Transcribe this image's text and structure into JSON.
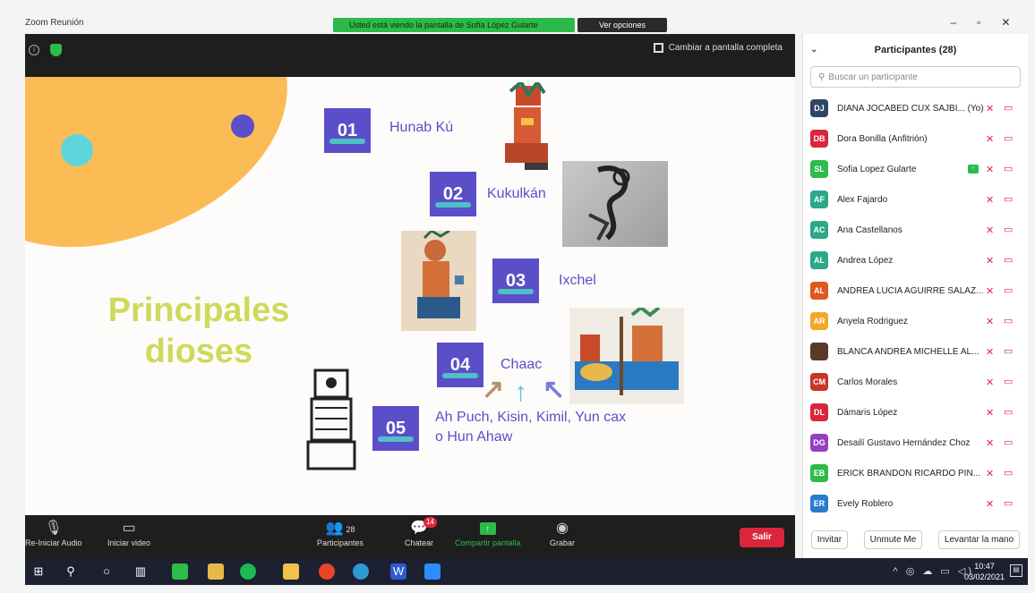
{
  "window": {
    "title": "Zoom Reunión",
    "share_banner": "Usted está viendo la pantalla de Sofía López Gularte",
    "view_options": "Ver opciones"
  },
  "top_bar": {
    "fullscreen_label": "Cambiar a pantalla completa"
  },
  "slide": {
    "title_line1": "Principales",
    "title_line2": "dioses",
    "items": [
      {
        "num": "01",
        "label": "Hunab Kú"
      },
      {
        "num": "02",
        "label": "Kukulkán"
      },
      {
        "num": "03",
        "label": "Ixchel"
      },
      {
        "num": "04",
        "label": "Chaac"
      },
      {
        "num": "05",
        "label_line1": "Ah Puch, Kisin, Kimil, Yun cax",
        "label_line2": "o Hun Ahaw"
      }
    ],
    "colors": {
      "accent": "#5a4fc9",
      "title": "#cbdb5a",
      "blob": "#fcbc55",
      "teal": "#5cd6dc"
    }
  },
  "toolbar": {
    "audio_label": "Re-Iniciar Audio",
    "video_label": "Iniciar video",
    "participants_label": "Participantes",
    "participants_count": "28",
    "chat_label": "Chatear",
    "chat_badge": "14",
    "share_label": "Compartir pantalla",
    "record_label": "Grabar",
    "leave_label": "Salir"
  },
  "panel": {
    "title": "Participantes (28)",
    "search_placeholder": "Buscar un participante",
    "participants": [
      {
        "initials": "DJ",
        "name": "DIANA JOCABED CUX SAJBI... (Yo)",
        "color": "#2e4663"
      },
      {
        "initials": "DB",
        "name": "Dora Bonilla (Anfitrión)",
        "color": "#d9263a"
      },
      {
        "initials": "SL",
        "name": "Sofia Lopez Gularte",
        "color": "#2dbb4c",
        "sharing": true
      },
      {
        "initials": "AF",
        "name": "Alex Fajardo",
        "color": "#2aa889"
      },
      {
        "initials": "AC",
        "name": "Ana Castellanos",
        "color": "#2aa889"
      },
      {
        "initials": "AL",
        "name": "Andrea López",
        "color": "#2aa889"
      },
      {
        "initials": "AL",
        "name": "ANDREA LUCIA AGUIRRE SALAZ...",
        "color": "#e0571f"
      },
      {
        "initials": "AR",
        "name": "Anyela Rodriguez",
        "color": "#f4a62a"
      },
      {
        "initials": "",
        "name": "BLANCA ANDREA MICHELLE AL...",
        "color": "#5a3a2a"
      },
      {
        "initials": "CM",
        "name": "Carlos Morales",
        "color": "#c8362a"
      },
      {
        "initials": "DL",
        "name": "Dámaris López",
        "color": "#d9263a"
      },
      {
        "initials": "DG",
        "name": "Desailí Gustavo Hernández Choz",
        "color": "#9540c0"
      },
      {
        "initials": "EB",
        "name": "ERICK BRANDON RICARDO PIN...",
        "color": "#2dbb4c"
      },
      {
        "initials": "ER",
        "name": "Evely Roblero",
        "color": "#2d7ad1"
      }
    ],
    "invite_label": "Invitar",
    "unmute_label": "Unmute Me",
    "raise_hand_label": "Levantar la mano"
  },
  "taskbar": {
    "time": "10:47",
    "date": "03/02/2021"
  }
}
